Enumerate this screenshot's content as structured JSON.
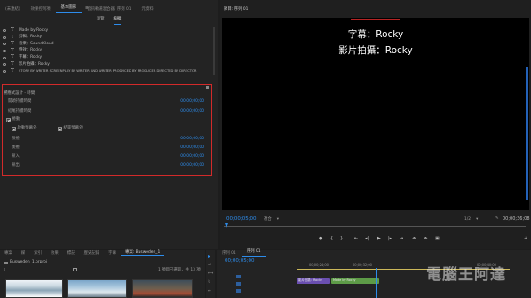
{
  "top_tabs": [
    "(未連結)",
    "效果控制項",
    "基本圖形",
    "音訊軌道混合器: 序列 01",
    "元資料"
  ],
  "graphics": {
    "subtabs": [
      "瀏覽",
      "編輯"
    ],
    "layers": [
      "Made by Rocky",
      "剪輯：Rocky",
      "音樂：SoundCloud",
      "特效：Rocky",
      "字幕：Rocky",
      "影片拍攝：Rocky",
      "STORY BY WRITER SCREENPLAY BY WRITER AND WRITER PRODUCED BY PRODUCER DIRECTED BY DIRECTOR"
    ],
    "section_title": "響應式設計 - 時間",
    "start_label": "開頭持續時間",
    "start_value": "00;00;00;00",
    "end_label": "結尾持續時間",
    "end_value": "00;00;00;00",
    "roll_label": "捲動",
    "offscreen_start_label": "啟動螢幕外",
    "offscreen_end_label": "結束螢幕外",
    "preroll_label": "預捲",
    "preroll_value": "00;00;00;00",
    "postroll_label": "後捲",
    "postroll_value": "00;00;00;00",
    "easein_label": "漸入",
    "easein_value": "00;00;00;00",
    "easeout_label": "漸出",
    "easeout_value": "00;00;00;00"
  },
  "program": {
    "title": "節目: 序列 01",
    "lines": [
      "字幕：Rocky",
      "影片拍攝：Rocky"
    ],
    "timecode": "00;00;05;00",
    "fit": "適合",
    "quality": "1/2",
    "duration": "00;00;36;08"
  },
  "bottom_tabs": [
    "專案",
    "媒",
    "索引",
    "效果",
    "標記",
    "歷史記錄",
    "字幕",
    "專案: Busweden_1"
  ],
  "project": {
    "file": "Busweden_1.prproj",
    "selected": "1 項目已選取，共 13 項"
  },
  "timeline": {
    "tabs": [
      "序列 01",
      "序列 01"
    ],
    "timecode": "00;00;05;00",
    "ruler": [
      "00;00;24;00",
      "00;00;32;00",
      "00;00;40;00"
    ],
    "clips": [
      "影片拍攝：Rocky",
      "Made by Rocky"
    ]
  },
  "watermark": "電腦王阿達"
}
